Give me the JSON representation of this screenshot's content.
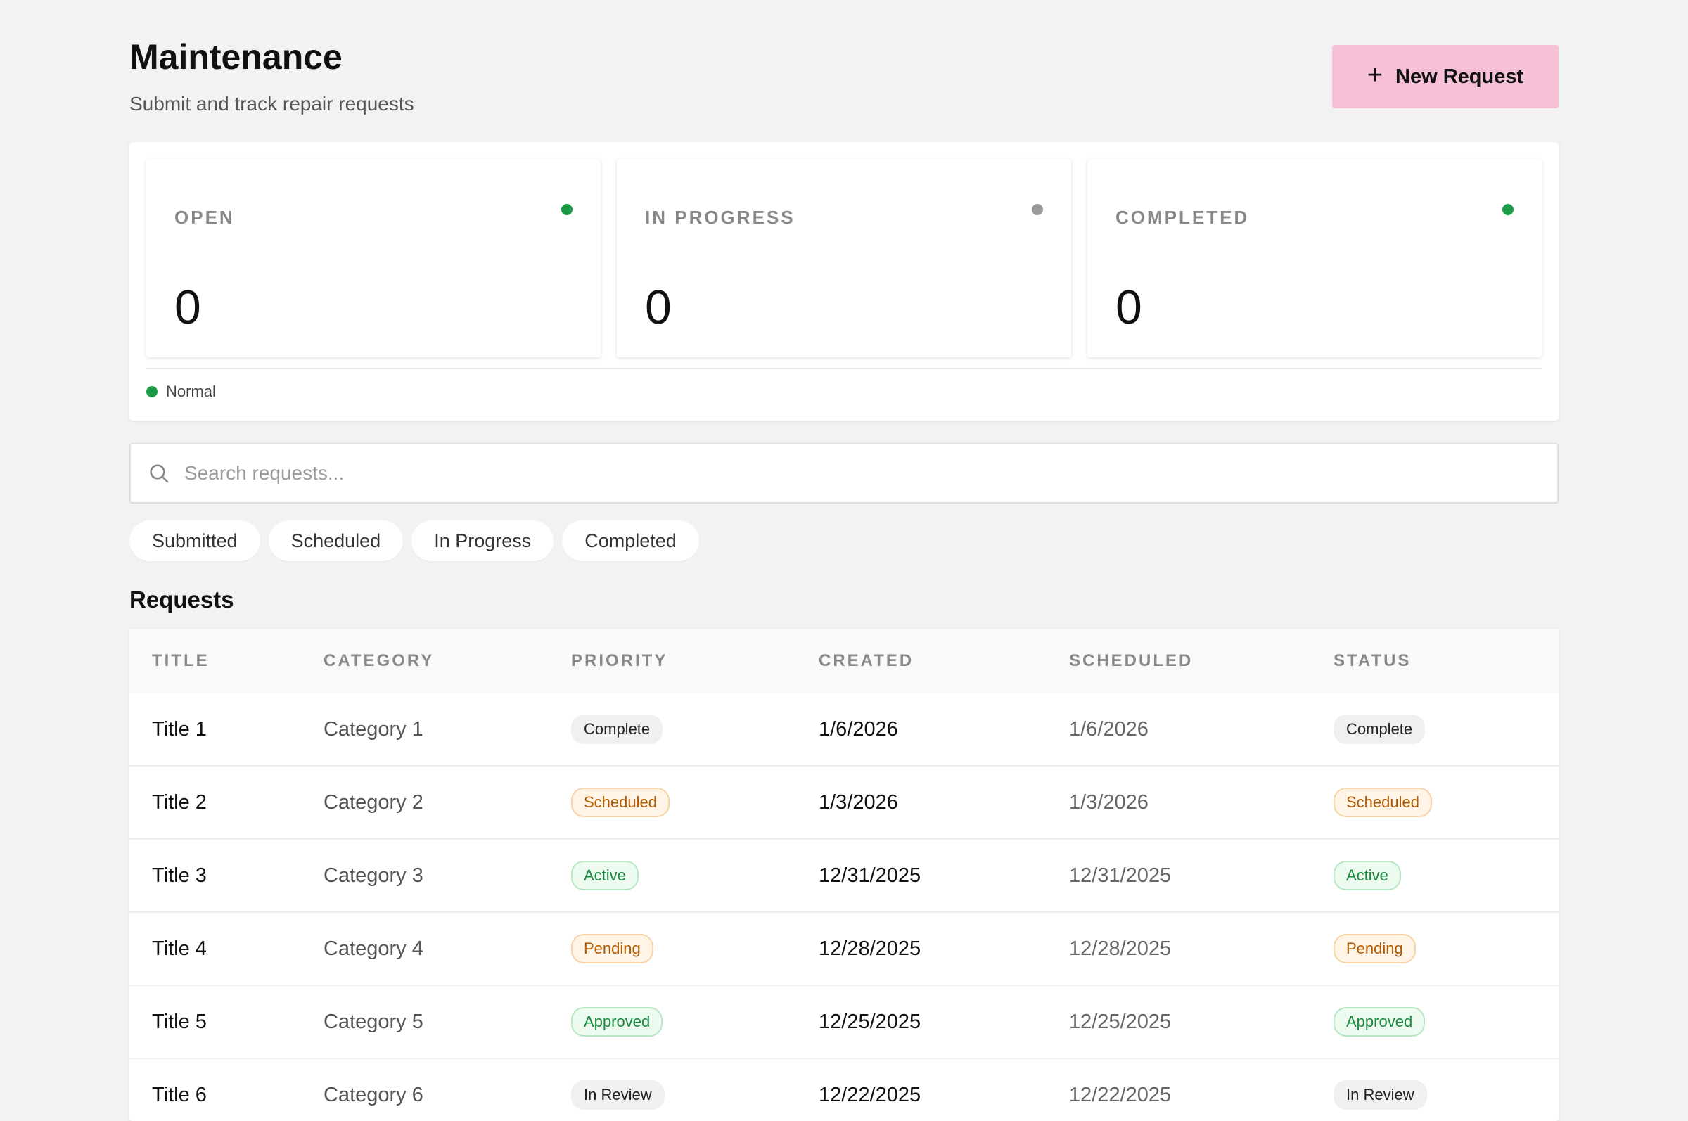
{
  "header": {
    "title": "Maintenance",
    "subtitle": "Submit and track repair requests",
    "new_button_label": "New Request",
    "new_button_icon": "plus-icon"
  },
  "stats": [
    {
      "label": "OPEN",
      "value": "0",
      "dot_color": "#1a9a45"
    },
    {
      "label": "IN PROGRESS",
      "value": "0",
      "dot_color": "#9a9a9a"
    },
    {
      "label": "COMPLETED",
      "value": "0",
      "dot_color": "#1a9a45"
    }
  ],
  "legend": {
    "label": "Normal",
    "dot_color": "#1a9a45"
  },
  "search": {
    "placeholder": "Search requests...",
    "value": "",
    "icon": "search-icon"
  },
  "filters": [
    "Submitted",
    "Scheduled",
    "In Progress",
    "Completed"
  ],
  "requests": {
    "section_title": "Requests",
    "columns": [
      "TITLE",
      "CATEGORY",
      "PRIORITY",
      "CREATED",
      "SCHEDULED",
      "STATUS"
    ],
    "rows": [
      {
        "title": "Title 1",
        "category": "Category 1",
        "priority": "Complete",
        "created": "1/6/2026",
        "scheduled": "1/6/2026",
        "status": "Complete"
      },
      {
        "title": "Title 2",
        "category": "Category 2",
        "priority": "Scheduled",
        "created": "1/3/2026",
        "scheduled": "1/3/2026",
        "status": "Scheduled"
      },
      {
        "title": "Title 3",
        "category": "Category 3",
        "priority": "Active",
        "created": "12/31/2025",
        "scheduled": "12/31/2025",
        "status": "Active"
      },
      {
        "title": "Title 4",
        "category": "Category 4",
        "priority": "Pending",
        "created": "12/28/2025",
        "scheduled": "12/28/2025",
        "status": "Pending"
      },
      {
        "title": "Title 5",
        "category": "Category 5",
        "priority": "Approved",
        "created": "12/25/2025",
        "scheduled": "12/25/2025",
        "status": "Approved"
      },
      {
        "title": "Title 6",
        "category": "Category 6",
        "priority": "In Review",
        "created": "12/22/2025",
        "scheduled": "12/22/2025",
        "status": "In Review"
      }
    ]
  }
}
